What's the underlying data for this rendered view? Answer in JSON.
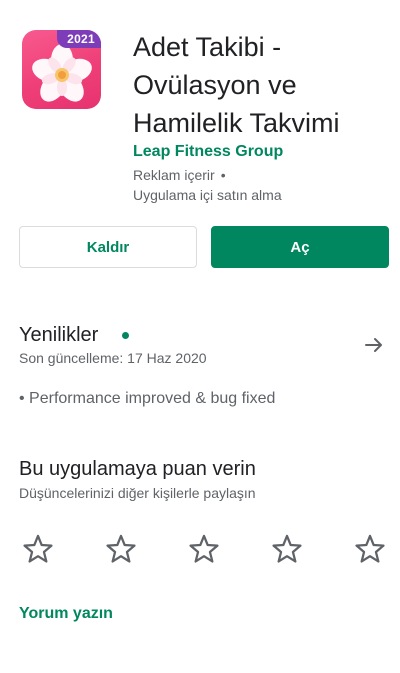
{
  "app": {
    "year_badge": "2021",
    "title_line1": "Adet Takibi -",
    "title_line2": "Ovülasyon ve",
    "title_line3": "Hamilelik Takvimi",
    "developer": "Leap Fitness Group",
    "ads_notice": "Reklam içerir",
    "ads_separator": "•",
    "iap_notice": "Uygulama içi satın alma",
    "icon_colors": {
      "background": "#ef3f78",
      "badge": "#7d3cb8",
      "petal": "#ffffff",
      "center": "#f7c66a"
    }
  },
  "actions": {
    "uninstall_label": "Kaldır",
    "open_label": "Aç"
  },
  "whats_new": {
    "title": "Yenilikler",
    "last_updated": "Son güncelleme: 17 Haz 2020",
    "changelog": "• Performance improved & bug fixed"
  },
  "rating": {
    "title": "Bu uygulamaya puan verin",
    "subtitle": "Düşüncelerinizi diğer kişilerle paylaşın",
    "stars_filled": 0,
    "star_count": 5
  },
  "review": {
    "write_label": "Yorum yazın"
  },
  "theme": {
    "accent": "#01875f",
    "text_primary": "#202124",
    "text_secondary": "#5f6368"
  }
}
